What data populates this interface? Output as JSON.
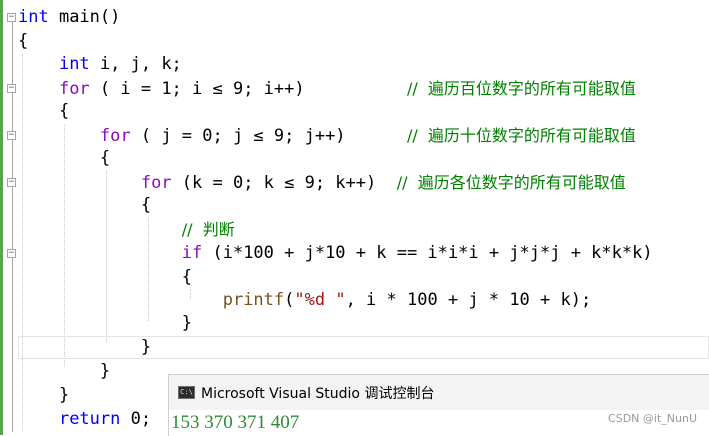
{
  "code": {
    "line1": {
      "kw": "int",
      "rest": " main()"
    },
    "line2": "{",
    "line3": {
      "kw": "int",
      "rest": " i, j, k;"
    },
    "line4": {
      "kw": "for",
      "code": " ( i = 1; i ≤ 9; i++)",
      "comment": "//  遍历百位数字的所有可能取值"
    },
    "line5": "{",
    "line6": {
      "kw": "for",
      "code": " ( j = 0; j ≤ 9; j++)",
      "comment": "//  遍历十位数字的所有可能取值"
    },
    "line7": "{",
    "line8": {
      "kw": "for",
      "code": " (k = 0; k ≤ 9; k++)",
      "comment": "//  遍历各位数字的所有可能取值"
    },
    "line9": "{",
    "line10": {
      "comment": "//  判断"
    },
    "line11": {
      "kw": "if",
      "code": " (i*100 + j*10 + k == i*i*i + j*j*j + k*k*k)"
    },
    "line12": "{",
    "line13": {
      "fn": "printf",
      "open": "(",
      "str": "\"%d \"",
      "rest": ", i * 100 + j * 10 + k);"
    },
    "line14": "}",
    "line15": "}",
    "line16": "}",
    "line17": "}",
    "line18": {
      "kw": "return",
      "rest": " 0;"
    }
  },
  "console": {
    "icon_text": "C:\\",
    "title": "Microsoft Visual Studio 调试控制台",
    "output": "153 370 371 407"
  },
  "watermark": "CSDN @it_NunU"
}
